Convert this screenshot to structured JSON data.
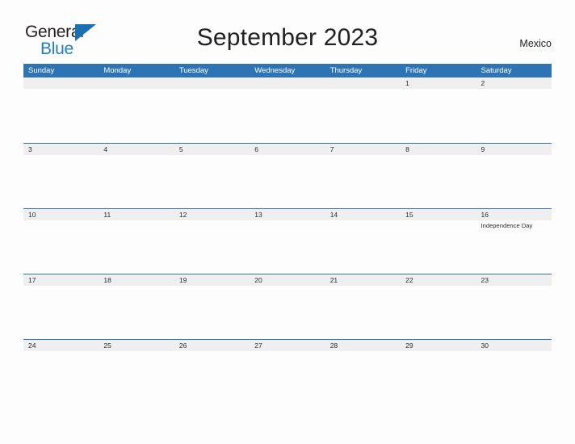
{
  "logo": {
    "word1": "General",
    "word2": "Blue",
    "flag_icon": "blue-flag-triangle",
    "color_dark": "#231f20",
    "color_blue": "#1f7fc4"
  },
  "header": {
    "title": "September 2023",
    "country": "Mexico"
  },
  "theme": {
    "header_blue": "#2e74b5",
    "band_gray": "#efefef",
    "page_bg": "#fdfdfd",
    "text_dark": "#2b2b2b"
  },
  "calendar": {
    "month": "September",
    "year": "2023",
    "weekday_headers": [
      "Sunday",
      "Monday",
      "Tuesday",
      "Wednesday",
      "Thursday",
      "Friday",
      "Saturday"
    ],
    "weeks": [
      {
        "days": [
          {
            "num": "",
            "events": []
          },
          {
            "num": "",
            "events": []
          },
          {
            "num": "",
            "events": []
          },
          {
            "num": "",
            "events": []
          },
          {
            "num": "",
            "events": []
          },
          {
            "num": "1",
            "events": []
          },
          {
            "num": "2",
            "events": []
          }
        ]
      },
      {
        "days": [
          {
            "num": "3",
            "events": []
          },
          {
            "num": "4",
            "events": []
          },
          {
            "num": "5",
            "events": []
          },
          {
            "num": "6",
            "events": []
          },
          {
            "num": "7",
            "events": []
          },
          {
            "num": "8",
            "events": []
          },
          {
            "num": "9",
            "events": []
          }
        ]
      },
      {
        "days": [
          {
            "num": "10",
            "events": []
          },
          {
            "num": "11",
            "events": []
          },
          {
            "num": "12",
            "events": []
          },
          {
            "num": "13",
            "events": []
          },
          {
            "num": "14",
            "events": []
          },
          {
            "num": "15",
            "events": []
          },
          {
            "num": "16",
            "events": [
              "Independence Day"
            ]
          }
        ]
      },
      {
        "days": [
          {
            "num": "17",
            "events": []
          },
          {
            "num": "18",
            "events": []
          },
          {
            "num": "19",
            "events": []
          },
          {
            "num": "20",
            "events": []
          },
          {
            "num": "21",
            "events": []
          },
          {
            "num": "22",
            "events": []
          },
          {
            "num": "23",
            "events": []
          }
        ]
      },
      {
        "days": [
          {
            "num": "24",
            "events": []
          },
          {
            "num": "25",
            "events": []
          },
          {
            "num": "26",
            "events": []
          },
          {
            "num": "27",
            "events": []
          },
          {
            "num": "28",
            "events": []
          },
          {
            "num": "29",
            "events": []
          },
          {
            "num": "30",
            "events": []
          }
        ]
      }
    ]
  }
}
